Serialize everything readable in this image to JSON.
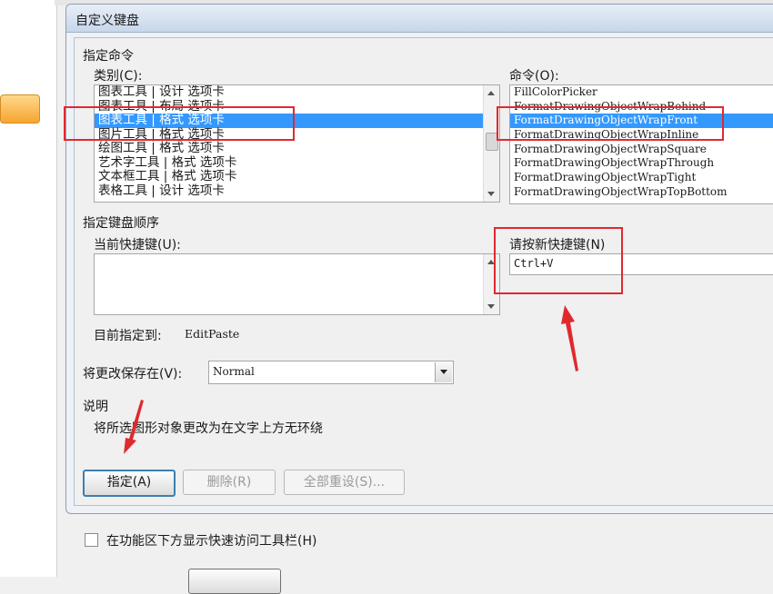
{
  "dialog": {
    "title": "自定义键盘"
  },
  "specify_command": {
    "group_label": "指定命令",
    "category_label": "类别(C):",
    "categories": [
      "图表工具 | 设计 选项卡",
      "图表工具 | 布局 选项卡",
      "图表工具 | 格式 选项卡",
      "图片工具 | 格式 选项卡",
      "绘图工具 | 格式 选项卡",
      "艺术字工具 | 格式 选项卡",
      "文本框工具 | 格式 选项卡",
      "表格工具 | 设计 选项卡"
    ],
    "selected_category_index": 2,
    "command_label": "命令(O):",
    "commands": [
      "FillColorPicker",
      "FormatDrawingObjectWrapBehind",
      "FormatDrawingObjectWrapFront",
      "FormatDrawingObjectWrapInline",
      "FormatDrawingObjectWrapSquare",
      "FormatDrawingObjectWrapThrough",
      "FormatDrawingObjectWrapTight",
      "FormatDrawingObjectWrapTopBottom"
    ],
    "selected_command_index": 2
  },
  "key_sequence": {
    "group_label": "指定键盘顺序",
    "current_keys_label": "当前快捷键(U):",
    "new_key_label": "请按新快捷键(N)",
    "new_key_value": "Ctrl+V",
    "assigned_to_label": "目前指定到:",
    "assigned_to_value": "EditPaste"
  },
  "save_in": {
    "label": "将更改保存在(V):",
    "value": "Normal"
  },
  "description": {
    "label": "说明",
    "text": "将所选图形对象更改为在文字上方无环绕"
  },
  "buttons": {
    "assign": "指定(A)",
    "remove": "删除(R)",
    "reset_all": "全部重设(S)..."
  },
  "checkbox": {
    "label": "在功能区下方显示快速访问工具栏(H)",
    "checked": false
  },
  "colors": {
    "selection": "#3399ff",
    "annotation_red": "#e0292f"
  }
}
